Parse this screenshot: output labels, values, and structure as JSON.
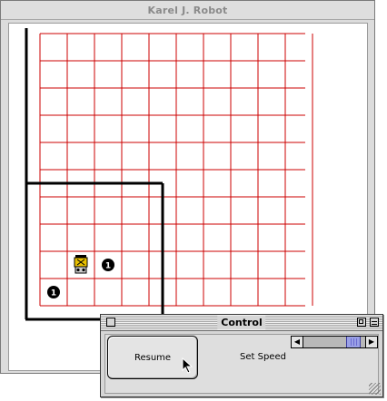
{
  "main_window": {
    "title": "Karel J. Robot"
  },
  "world": {
    "streets": 10,
    "avenues": 10,
    "grid_color": "#cc0000",
    "wall_color": "#000000",
    "robot": {
      "street": 2,
      "avenue": 2,
      "direction": "north",
      "body_color": "#e8c000"
    },
    "beepers": [
      {
        "street": 2,
        "avenue": 3,
        "count": "1"
      },
      {
        "street": 1,
        "avenue": 1,
        "count": "1"
      }
    ]
  },
  "control_window": {
    "title": "Control",
    "resume_label": "Resume",
    "speed_label": "Set Speed",
    "speed_level": 0.9
  },
  "icons": [
    "close-box-icon",
    "zoom-box-icon",
    "collapse-box-icon",
    "left-arrow-icon",
    "right-arrow-icon",
    "grow-box-icon",
    "cursor-arrow-icon",
    "robot-icon",
    "beeper-icon"
  ]
}
